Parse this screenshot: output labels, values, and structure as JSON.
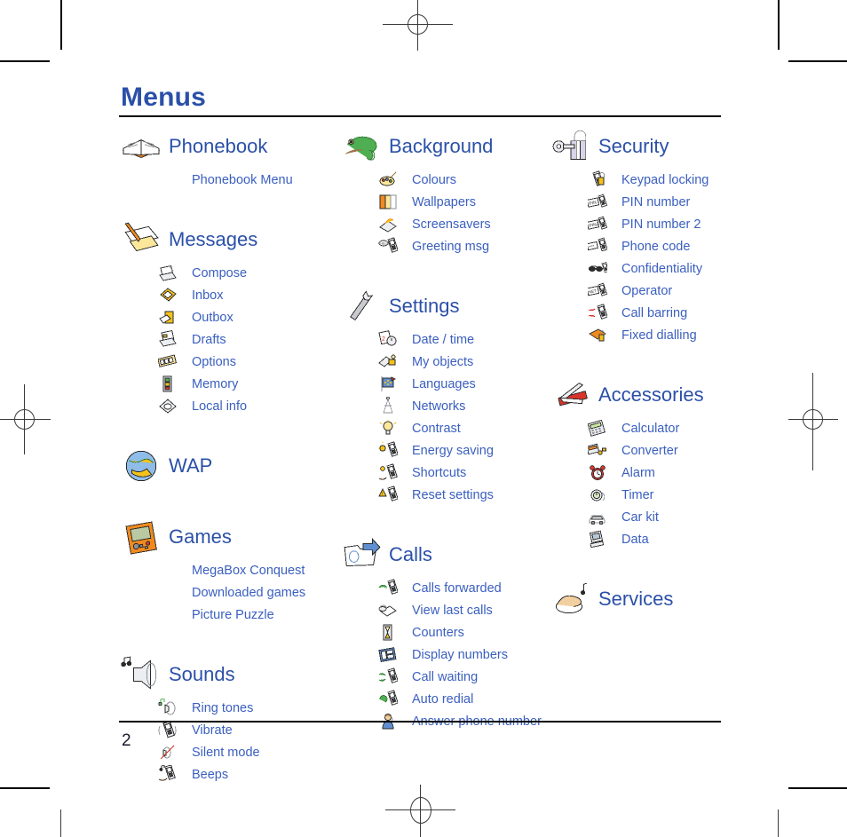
{
  "page": {
    "title": "Menus",
    "number": "2"
  },
  "columns": [
    {
      "id": "col-left",
      "groups": [
        {
          "title": "Phonebook",
          "icon": "open-book-icon",
          "items": [
            {
              "label": "Phonebook Menu",
              "icon": ""
            }
          ]
        },
        {
          "title": "Messages",
          "icon": "message-pencil-icon",
          "items": [
            {
              "label": "Compose",
              "icon": "compose-icon"
            },
            {
              "label": "Inbox",
              "icon": "inbox-icon"
            },
            {
              "label": "Outbox",
              "icon": "outbox-icon"
            },
            {
              "label": "Drafts",
              "icon": "drafts-icon"
            },
            {
              "label": "Options",
              "icon": "options-icon"
            },
            {
              "label": "Memory",
              "icon": "memory-icon"
            },
            {
              "label": "Local info",
              "icon": "local-info-icon"
            }
          ]
        },
        {
          "title": "WAP",
          "icon": "globe-icon",
          "items": []
        },
        {
          "title": "Games",
          "icon": "gameboy-icon",
          "items": [
            {
              "label": "MegaBox Conquest",
              "icon": ""
            },
            {
              "label": "Downloaded games",
              "icon": ""
            },
            {
              "label": "Picture Puzzle",
              "icon": ""
            }
          ]
        },
        {
          "title": "Sounds",
          "icon": "speaker-notes-icon",
          "items": [
            {
              "label": "Ring tones",
              "icon": "ring-tones-icon"
            },
            {
              "label": "Vibrate",
              "icon": "vibrate-icon"
            },
            {
              "label": "Silent mode",
              "icon": "silent-mode-icon"
            },
            {
              "label": "Beeps",
              "icon": "beeps-icon"
            }
          ]
        }
      ]
    },
    {
      "id": "col-mid",
      "groups": [
        {
          "title": "Background",
          "icon": "chameleon-icon",
          "items": [
            {
              "label": "Colours",
              "icon": "palette-icon"
            },
            {
              "label": "Wallpapers",
              "icon": "wallpapers-icon"
            },
            {
              "label": "Screensavers",
              "icon": "screensavers-icon"
            },
            {
              "label": "Greeting msg",
              "icon": "greeting-msg-icon"
            }
          ]
        },
        {
          "title": "Settings",
          "icon": "wrench-icon",
          "items": [
            {
              "label": "Date / time",
              "icon": "date-time-icon"
            },
            {
              "label": "My objects",
              "icon": "my-objects-icon"
            },
            {
              "label": "Languages",
              "icon": "languages-flag-icon"
            },
            {
              "label": "Networks",
              "icon": "networks-antenna-icon"
            },
            {
              "label": "Contrast",
              "icon": "contrast-bulb-icon"
            },
            {
              "label": "Energy saving",
              "icon": "energy-saving-icon"
            },
            {
              "label": "Shortcuts",
              "icon": "shortcuts-icon"
            },
            {
              "label": "Reset settings",
              "icon": "reset-settings-icon"
            }
          ]
        },
        {
          "title": "Calls",
          "icon": "calls-folder-arrow-icon",
          "items": [
            {
              "label": "Calls forwarded",
              "icon": "calls-forwarded-icon"
            },
            {
              "label": "View last calls",
              "icon": "view-last-calls-icon"
            },
            {
              "label": "Counters",
              "icon": "hourglass-icon"
            },
            {
              "label": "Display numbers",
              "icon": "display-numbers-icon"
            },
            {
              "label": "Call waiting",
              "icon": "call-waiting-icon"
            },
            {
              "label": "Auto redial",
              "icon": "auto-redial-icon"
            },
            {
              "label": "Answer phone number",
              "icon": "answer-phone-icon"
            }
          ]
        }
      ]
    },
    {
      "id": "col-right",
      "groups": [
        {
          "title": "Security",
          "icon": "padlock-key-icon",
          "items": [
            {
              "label": "Keypad locking",
              "icon": "keypad-locking-icon"
            },
            {
              "label": "PIN number",
              "icon": "pin-number-icon"
            },
            {
              "label": "PIN number 2",
              "icon": "pin-number-2-icon"
            },
            {
              "label": "Phone code",
              "icon": "phone-code-icon"
            },
            {
              "label": "Confidentiality",
              "icon": "confidentiality-icon"
            },
            {
              "label": "Operator",
              "icon": "operator-icon"
            },
            {
              "label": "Call barring",
              "icon": "call-barring-icon"
            },
            {
              "label": "Fixed dialling",
              "icon": "fixed-dialling-icon"
            }
          ]
        },
        {
          "title": "Accessories",
          "icon": "swiss-knife-icon",
          "items": [
            {
              "label": "Calculator",
              "icon": "calculator-icon"
            },
            {
              "label": "Converter",
              "icon": "converter-icon"
            },
            {
              "label": "Alarm",
              "icon": "alarm-clock-icon"
            },
            {
              "label": "Timer",
              "icon": "timer-icon"
            },
            {
              "label": "Car kit",
              "icon": "car-kit-icon"
            },
            {
              "label": "Data",
              "icon": "data-icon"
            }
          ]
        },
        {
          "title": "Services",
          "icon": "services-hand-icon",
          "items": []
        }
      ]
    }
  ],
  "colors": {
    "title": "#2b50a8",
    "group_title": "#2b50a8",
    "item_label": "#3a5fbf",
    "rule": "#000000",
    "page_number": "#1a1a2e"
  }
}
